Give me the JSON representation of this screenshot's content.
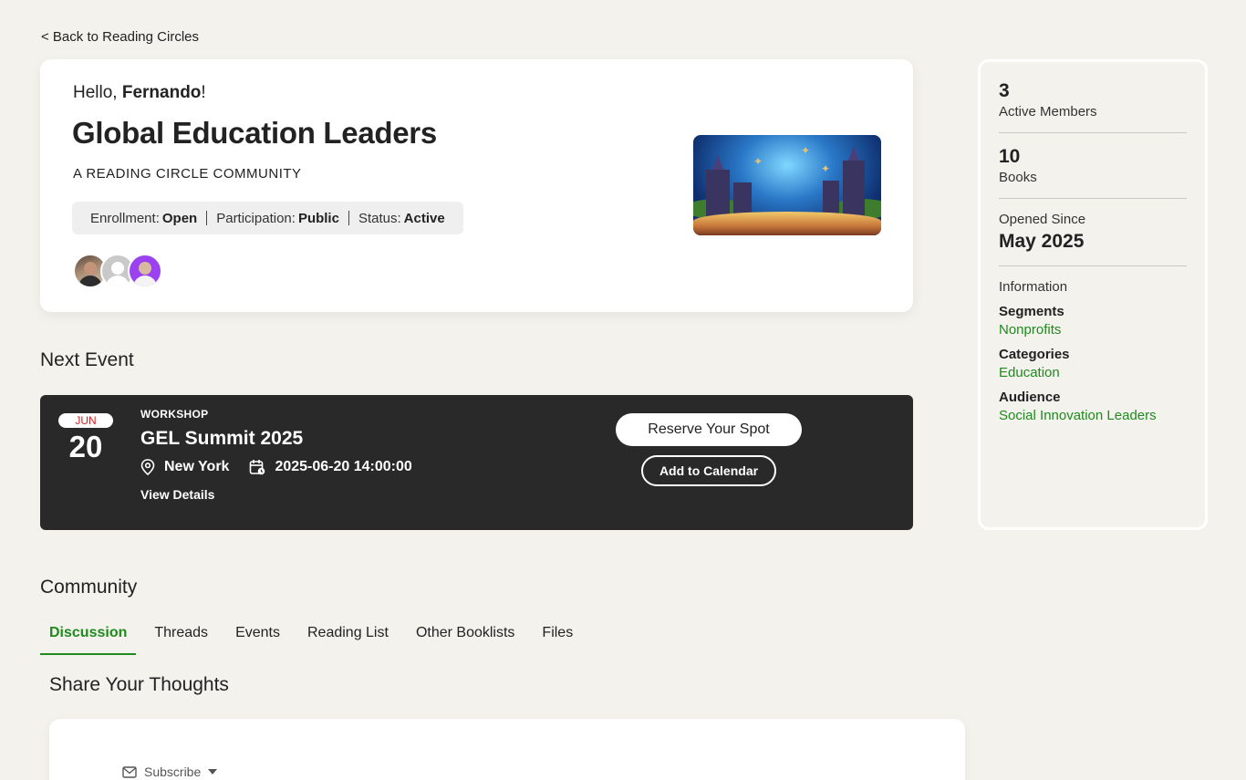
{
  "back_link": "< Back to Reading Circles",
  "hero": {
    "greeting_prefix": "Hello, ",
    "user_name": "Fernando",
    "greeting_suffix": "!",
    "title": "Global Education Leaders",
    "subtitle": "A READING CIRCLE COMMUNITY",
    "meta": [
      {
        "label": "Enrollment:",
        "value": "Open"
      },
      {
        "label": "Participation:",
        "value": "Public"
      },
      {
        "label": "Status:",
        "value": "Active"
      }
    ]
  },
  "next_event": {
    "heading": "Next Event",
    "month": "JUN",
    "day": "20",
    "type": "WORKSHOP",
    "title": "GEL Summit 2025",
    "location": "New York",
    "datetime": "2025-06-20 14:00:00",
    "view_details": "View Details",
    "reserve_label": "Reserve Your Spot",
    "calendar_label": "Add to Calendar"
  },
  "community": {
    "heading": "Community",
    "tabs": [
      "Discussion",
      "Threads",
      "Events",
      "Reading List",
      "Other Booklists",
      "Files"
    ],
    "active_tab": "Discussion",
    "share_heading": "Share Your Thoughts",
    "subscribe_label": "Subscribe"
  },
  "sidebar": {
    "members_count": "3",
    "members_label": "Active Members",
    "books_count": "10",
    "books_label": "Books",
    "opened_label": "Opened Since",
    "opened_value": "May 2025",
    "info_heading": "Information",
    "segments_label": "Segments",
    "segments_value": "Nonprofits",
    "categories_label": "Categories",
    "categories_value": "Education",
    "audience_label": "Audience",
    "audience_value": "Social Innovation Leaders"
  },
  "colors": {
    "accent_green": "#1f8a1f",
    "event_bg": "#292929",
    "page_bg": "#f3f2ec",
    "month_red": "#d32020"
  }
}
